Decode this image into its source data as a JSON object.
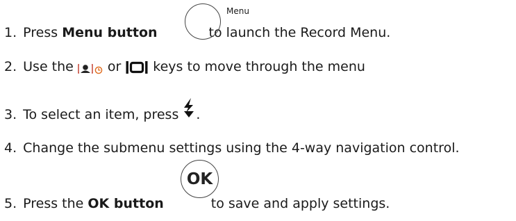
{
  "steps": [
    {
      "num": "1.",
      "pre": "Press ",
      "bold": "Menu button",
      "post": "to launch the Record Menu.",
      "icon_label": "Menu"
    },
    {
      "num": "2.",
      "pre": "Use the",
      "mid": "or",
      "post": "keys to move through the menu"
    },
    {
      "num": "3.",
      "pre": "To select an item, press",
      "post": "."
    },
    {
      "num": "4.",
      "text": "Change the submenu settings using the 4-way navigation control."
    },
    {
      "num": "5.",
      "pre": "Press the ",
      "bold": "OK button",
      "post": "to save and apply settings.",
      "icon_label": "OK"
    }
  ],
  "icons": {
    "menu_button": "menu-button-icon",
    "face_detect": "face-detect-icon",
    "self_timer": "self-timer-icon",
    "display_mode": "display-mode-icon",
    "flash": "flash-icon",
    "ok_button": "ok-button-icon"
  },
  "colors": {
    "text": "#1a1a1a",
    "icon_stroke": "#444444",
    "timer_accent": "#e06a1b"
  }
}
